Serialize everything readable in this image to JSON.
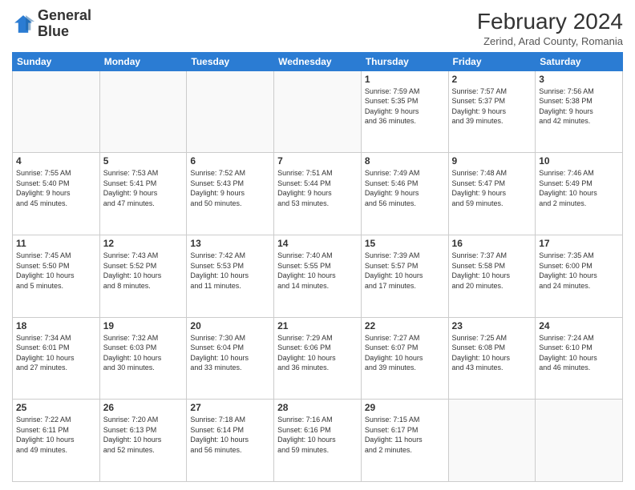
{
  "header": {
    "logo_line1": "General",
    "logo_line2": "Blue",
    "main_title": "February 2024",
    "subtitle": "Zerind, Arad County, Romania"
  },
  "days_of_week": [
    "Sunday",
    "Monday",
    "Tuesday",
    "Wednesday",
    "Thursday",
    "Friday",
    "Saturday"
  ],
  "weeks": [
    [
      {
        "day": "",
        "info": ""
      },
      {
        "day": "",
        "info": ""
      },
      {
        "day": "",
        "info": ""
      },
      {
        "day": "",
        "info": ""
      },
      {
        "day": "1",
        "info": "Sunrise: 7:59 AM\nSunset: 5:35 PM\nDaylight: 9 hours\nand 36 minutes."
      },
      {
        "day": "2",
        "info": "Sunrise: 7:57 AM\nSunset: 5:37 PM\nDaylight: 9 hours\nand 39 minutes."
      },
      {
        "day": "3",
        "info": "Sunrise: 7:56 AM\nSunset: 5:38 PM\nDaylight: 9 hours\nand 42 minutes."
      }
    ],
    [
      {
        "day": "4",
        "info": "Sunrise: 7:55 AM\nSunset: 5:40 PM\nDaylight: 9 hours\nand 45 minutes."
      },
      {
        "day": "5",
        "info": "Sunrise: 7:53 AM\nSunset: 5:41 PM\nDaylight: 9 hours\nand 47 minutes."
      },
      {
        "day": "6",
        "info": "Sunrise: 7:52 AM\nSunset: 5:43 PM\nDaylight: 9 hours\nand 50 minutes."
      },
      {
        "day": "7",
        "info": "Sunrise: 7:51 AM\nSunset: 5:44 PM\nDaylight: 9 hours\nand 53 minutes."
      },
      {
        "day": "8",
        "info": "Sunrise: 7:49 AM\nSunset: 5:46 PM\nDaylight: 9 hours\nand 56 minutes."
      },
      {
        "day": "9",
        "info": "Sunrise: 7:48 AM\nSunset: 5:47 PM\nDaylight: 9 hours\nand 59 minutes."
      },
      {
        "day": "10",
        "info": "Sunrise: 7:46 AM\nSunset: 5:49 PM\nDaylight: 10 hours\nand 2 minutes."
      }
    ],
    [
      {
        "day": "11",
        "info": "Sunrise: 7:45 AM\nSunset: 5:50 PM\nDaylight: 10 hours\nand 5 minutes."
      },
      {
        "day": "12",
        "info": "Sunrise: 7:43 AM\nSunset: 5:52 PM\nDaylight: 10 hours\nand 8 minutes."
      },
      {
        "day": "13",
        "info": "Sunrise: 7:42 AM\nSunset: 5:53 PM\nDaylight: 10 hours\nand 11 minutes."
      },
      {
        "day": "14",
        "info": "Sunrise: 7:40 AM\nSunset: 5:55 PM\nDaylight: 10 hours\nand 14 minutes."
      },
      {
        "day": "15",
        "info": "Sunrise: 7:39 AM\nSunset: 5:57 PM\nDaylight: 10 hours\nand 17 minutes."
      },
      {
        "day": "16",
        "info": "Sunrise: 7:37 AM\nSunset: 5:58 PM\nDaylight: 10 hours\nand 20 minutes."
      },
      {
        "day": "17",
        "info": "Sunrise: 7:35 AM\nSunset: 6:00 PM\nDaylight: 10 hours\nand 24 minutes."
      }
    ],
    [
      {
        "day": "18",
        "info": "Sunrise: 7:34 AM\nSunset: 6:01 PM\nDaylight: 10 hours\nand 27 minutes."
      },
      {
        "day": "19",
        "info": "Sunrise: 7:32 AM\nSunset: 6:03 PM\nDaylight: 10 hours\nand 30 minutes."
      },
      {
        "day": "20",
        "info": "Sunrise: 7:30 AM\nSunset: 6:04 PM\nDaylight: 10 hours\nand 33 minutes."
      },
      {
        "day": "21",
        "info": "Sunrise: 7:29 AM\nSunset: 6:06 PM\nDaylight: 10 hours\nand 36 minutes."
      },
      {
        "day": "22",
        "info": "Sunrise: 7:27 AM\nSunset: 6:07 PM\nDaylight: 10 hours\nand 39 minutes."
      },
      {
        "day": "23",
        "info": "Sunrise: 7:25 AM\nSunset: 6:08 PM\nDaylight: 10 hours\nand 43 minutes."
      },
      {
        "day": "24",
        "info": "Sunrise: 7:24 AM\nSunset: 6:10 PM\nDaylight: 10 hours\nand 46 minutes."
      }
    ],
    [
      {
        "day": "25",
        "info": "Sunrise: 7:22 AM\nSunset: 6:11 PM\nDaylight: 10 hours\nand 49 minutes."
      },
      {
        "day": "26",
        "info": "Sunrise: 7:20 AM\nSunset: 6:13 PM\nDaylight: 10 hours\nand 52 minutes."
      },
      {
        "day": "27",
        "info": "Sunrise: 7:18 AM\nSunset: 6:14 PM\nDaylight: 10 hours\nand 56 minutes."
      },
      {
        "day": "28",
        "info": "Sunrise: 7:16 AM\nSunset: 6:16 PM\nDaylight: 10 hours\nand 59 minutes."
      },
      {
        "day": "29",
        "info": "Sunrise: 7:15 AM\nSunset: 6:17 PM\nDaylight: 11 hours\nand 2 minutes."
      },
      {
        "day": "",
        "info": ""
      },
      {
        "day": "",
        "info": ""
      }
    ]
  ]
}
